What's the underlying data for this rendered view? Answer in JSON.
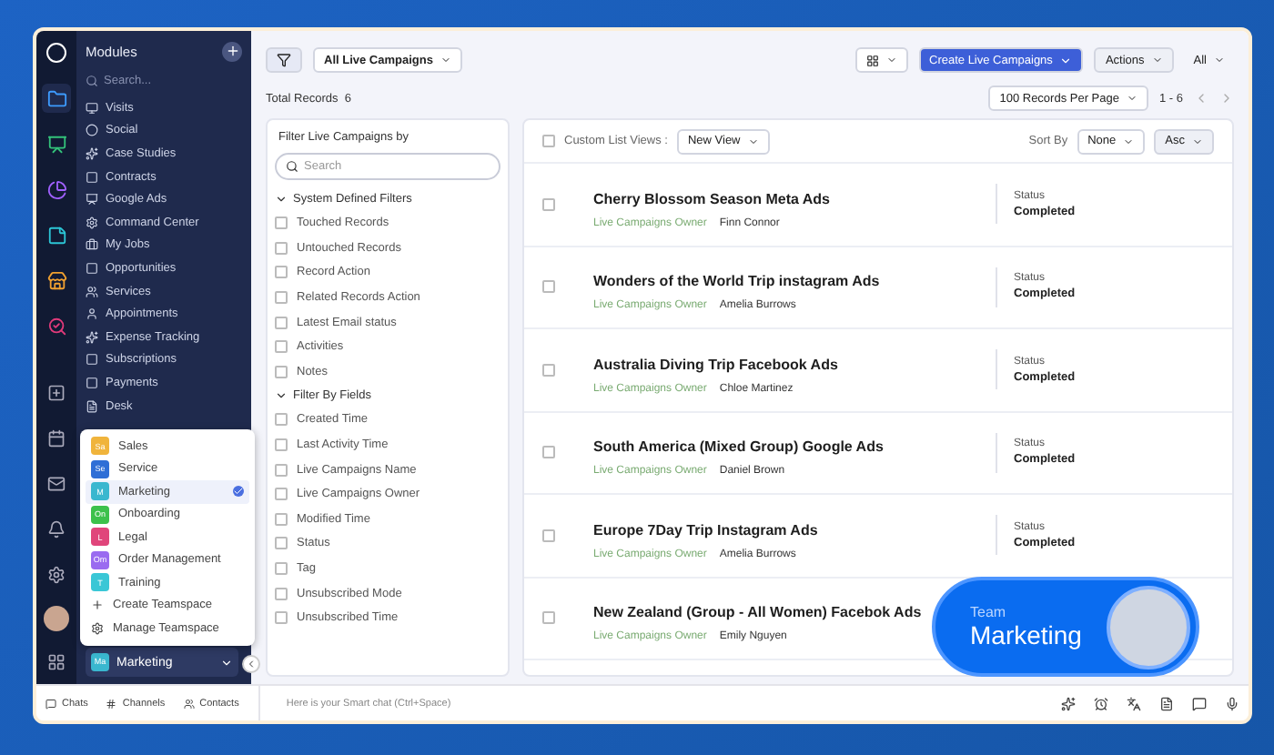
{
  "modules": {
    "title": "Modules",
    "search": {
      "placeholder": "Search..."
    },
    "items": [
      {
        "label": "Visits"
      },
      {
        "label": "Social"
      },
      {
        "label": "Case Studies"
      },
      {
        "label": "Contracts"
      },
      {
        "label": "Google Ads"
      },
      {
        "label": "Command Center"
      },
      {
        "label": "My Jobs"
      },
      {
        "label": "Opportunities"
      },
      {
        "label": "Services"
      },
      {
        "label": "Appointments"
      },
      {
        "label": "Expense Tracking"
      },
      {
        "label": "Subscriptions"
      },
      {
        "label": "Payments"
      },
      {
        "label": "Desk"
      }
    ]
  },
  "teamspace_menu": {
    "items": [
      {
        "badge": "Sa",
        "label": "Sales",
        "color": "#f0b43c",
        "selected": false
      },
      {
        "badge": "Se",
        "label": "Service",
        "color": "#2f6fd6",
        "selected": false
      },
      {
        "badge": "M",
        "label": "Marketing",
        "color": "#3ab7cf",
        "selected": true
      },
      {
        "badge": "On",
        "label": "Onboarding",
        "color": "#3cc14b",
        "selected": false
      },
      {
        "badge": "L",
        "label": "Legal",
        "color": "#e0457b",
        "selected": false
      },
      {
        "badge": "Om",
        "label": "Order Management",
        "color": "#9a6bf0",
        "selected": false
      },
      {
        "badge": "T",
        "label": "Training",
        "color": "#3ac7d6",
        "selected": false
      }
    ],
    "actions": [
      {
        "kind": "create",
        "label": "Create Teamspace"
      },
      {
        "kind": "manage",
        "label": "Manage Teamspace"
      }
    ]
  },
  "current_teamspace": {
    "badge": "Ma",
    "label": "Marketing"
  },
  "bottom_bar": {
    "tabs": [
      {
        "kind": "chats",
        "label": "Chats"
      },
      {
        "kind": "channels",
        "label": "Channels"
      },
      {
        "kind": "contacts",
        "label": "Contacts"
      }
    ],
    "smart_chat": {
      "placeholder": "Here is your Smart chat (Ctrl+Space)"
    }
  },
  "toolbar": {
    "view": "All Live Campaigns",
    "create_button": "Create Live Campaigns",
    "actions": "Actions",
    "filter_all": "All"
  },
  "total_records": {
    "label": "Total Records",
    "count": "6"
  },
  "pagination": {
    "per_page": "100 Records Per Page",
    "range": "1 - 6"
  },
  "filter_panel": {
    "title": "Filter Live Campaigns by",
    "search": {
      "placeholder": "Search"
    },
    "groups": [
      {
        "title": "System Defined Filters",
        "expanded": true,
        "items": [
          {
            "label": "Touched Records",
            "checked": false
          },
          {
            "label": "Untouched Records",
            "checked": false
          },
          {
            "label": "Record Action",
            "checked": false
          },
          {
            "label": "Related Records Action",
            "checked": false
          },
          {
            "label": "Latest Email status",
            "checked": false
          },
          {
            "label": "Activities",
            "checked": false
          },
          {
            "label": "Notes",
            "checked": false
          }
        ]
      },
      {
        "title": "Filter By Fields",
        "expanded": true,
        "items": [
          {
            "label": "Created Time",
            "checked": false
          },
          {
            "label": "Last Activity Time",
            "checked": false
          },
          {
            "label": "Live Campaigns Name",
            "checked": false
          },
          {
            "label": "Live Campaigns Owner",
            "checked": false
          },
          {
            "label": "Modified Time",
            "checked": false
          },
          {
            "label": "Status",
            "checked": false
          },
          {
            "label": "Tag",
            "checked": false
          },
          {
            "label": "Unsubscribed Mode",
            "checked": false
          },
          {
            "label": "Unsubscribed Time",
            "checked": false
          }
        ]
      }
    ]
  },
  "list": {
    "custom_views_label": "Custom List Views :",
    "custom_views_checked": false,
    "view": "New View",
    "sort_by_label": "Sort By",
    "sort_by": "None",
    "order": "Asc",
    "rows": [
      {
        "title": "Cherry Blossom Season Meta Ads",
        "owner_label": "Live Campaigns Owner",
        "owner": "Finn Connor",
        "status_label": "Status",
        "status": "Completed",
        "checked": false
      },
      {
        "title": "Wonders of the World Trip instagram Ads",
        "owner_label": "Live Campaigns Owner",
        "owner": "Amelia Burrows",
        "status_label": "Status",
        "status": "Completed",
        "checked": false
      },
      {
        "title": "Australia Diving Trip Facebook Ads",
        "owner_label": "Live Campaigns Owner",
        "owner": "Chloe Martinez",
        "status_label": "Status",
        "status": "Completed",
        "checked": false
      },
      {
        "title": "South America (Mixed Group) Google Ads",
        "owner_label": "Live Campaigns Owner",
        "owner": "Daniel Brown",
        "status_label": "Status",
        "status": "Completed",
        "checked": false
      },
      {
        "title": "Europe 7Day Trip Instagram Ads",
        "owner_label": "Live Campaigns Owner",
        "owner": "Amelia Burrows",
        "status_label": "Status",
        "status": "Completed",
        "checked": false
      },
      {
        "title": "New Zealand (Group - All Women) Facebok Ads",
        "owner_label": "Live Campaigns Owner",
        "owner": "Emily Nguyen",
        "status": "",
        "checked": false
      }
    ]
  },
  "team_badge": {
    "label": "Team",
    "name": "Marketing"
  }
}
